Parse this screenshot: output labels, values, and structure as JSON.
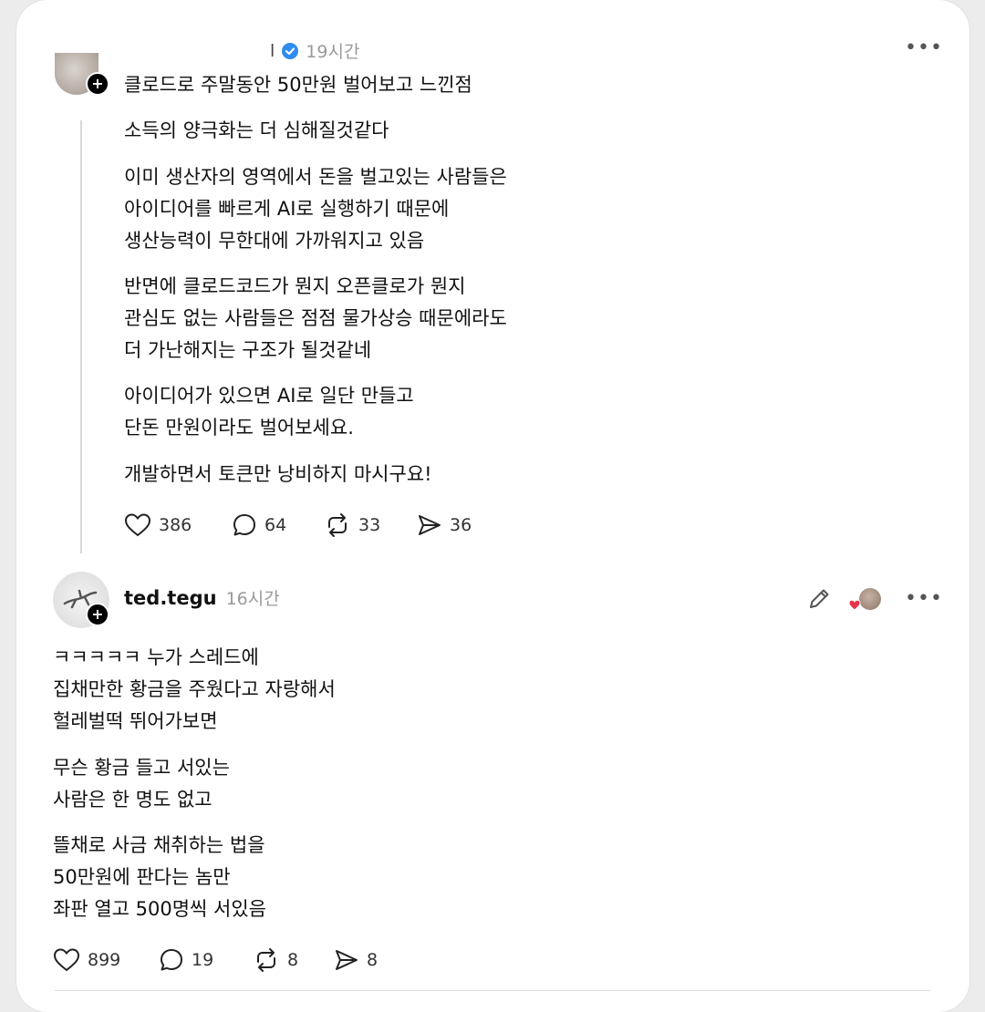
{
  "post1": {
    "time": "19시간",
    "title": "클로드로 주말동안 50만원 벌어보고 느낀점",
    "paragraphs": [
      "소득의 양극화는 더 심해질것같다",
      "이미 생산자의 영역에서 돈을 벌고있는 사람들은\n아이디어를 빠르게 AI로 실행하기 때문에\n생산능력이 무한대에 가까워지고 있음",
      "반면에 클로드코드가 뭔지 오픈클로가 뭔지\n관심도 없는 사람들은 점점 물가상승 때문에라도\n더 가난해지는 구조가 될것같네",
      "아이디어가 있으면 AI로 일단 만들고\n단돈 만원이라도 벌어보세요.",
      "개발하면서 토큰만 낭비하지 마시구요!"
    ],
    "likes": "386",
    "comments": "64",
    "reposts": "33",
    "shares": "36"
  },
  "post2": {
    "username": "ted.tegu",
    "time": "16시간",
    "paragraphs": [
      "ㅋㅋㅋㅋㅋ 누가 스레드에\n집채만한 황금을 주웠다고 자랑해서\n헐레벌떡 뛰어가보면",
      "무슨 황금 들고 서있는\n사람은 한 명도 없고",
      "뜰채로 사금 채취하는 법을\n50만원에 판다는 놈만\n좌판 열고 500명씩 서있음"
    ],
    "likes": "899",
    "comments": "19",
    "reposts": "8",
    "shares": "8"
  },
  "icons": {
    "more": "more-icon",
    "like": "heart-icon",
    "comment": "comment-icon",
    "repost": "repost-icon",
    "share": "share-icon",
    "edit": "pencil-icon",
    "verified": "verified-badge-icon",
    "follow": "plus-icon"
  },
  "colors": {
    "verified": "#2f8cf0",
    "liked_heart": "#e8334a"
  }
}
